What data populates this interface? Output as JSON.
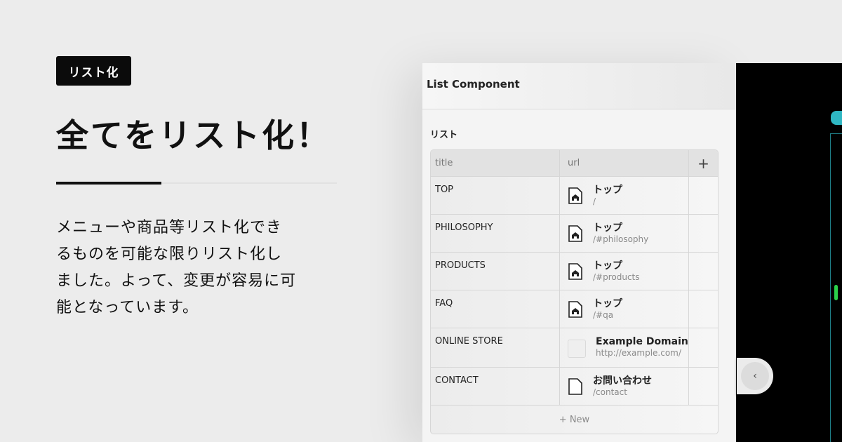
{
  "promo": {
    "badge": "リスト化",
    "headline": "全てをリスト化！",
    "description_lines": [
      "メニューや商品等リスト化でき",
      "るものを可能な限りリスト化し",
      "ました。よって、変更が容易に可",
      "能となっています。"
    ]
  },
  "panel": {
    "title": "List Component",
    "section_label": "リスト",
    "columns": {
      "title": "title",
      "url": "url",
      "add": "+"
    },
    "rows": [
      {
        "title": "TOP",
        "link_title": "トップ",
        "link_path": "/",
        "icon": "home-doc-icon"
      },
      {
        "title": "PHILOSOPHY",
        "link_title": "トップ",
        "link_path": "/#philosophy",
        "icon": "home-doc-icon"
      },
      {
        "title": "PRODUCTS",
        "link_title": "トップ",
        "link_path": "/#products",
        "icon": "home-doc-icon"
      },
      {
        "title": "FAQ",
        "link_title": "トップ",
        "link_path": "/#qa",
        "icon": "home-doc-icon"
      },
      {
        "title": "ONLINE STORE",
        "link_title": "Example Domain",
        "link_path": "http://example.com/",
        "icon": "external-thumb"
      },
      {
        "title": "CONTACT",
        "link_title": "お問い合わせ",
        "link_path": "/contact",
        "icon": "doc-icon"
      }
    ],
    "new_label": "+ New"
  },
  "preview": {
    "collapse_icon": "chevron-left-icon",
    "collapse_glyph": "‹"
  },
  "colors": {
    "accent_teal": "#2fb7c3",
    "indicator_green": "#2bd14a",
    "badge_bg": "#0b0b0b"
  }
}
